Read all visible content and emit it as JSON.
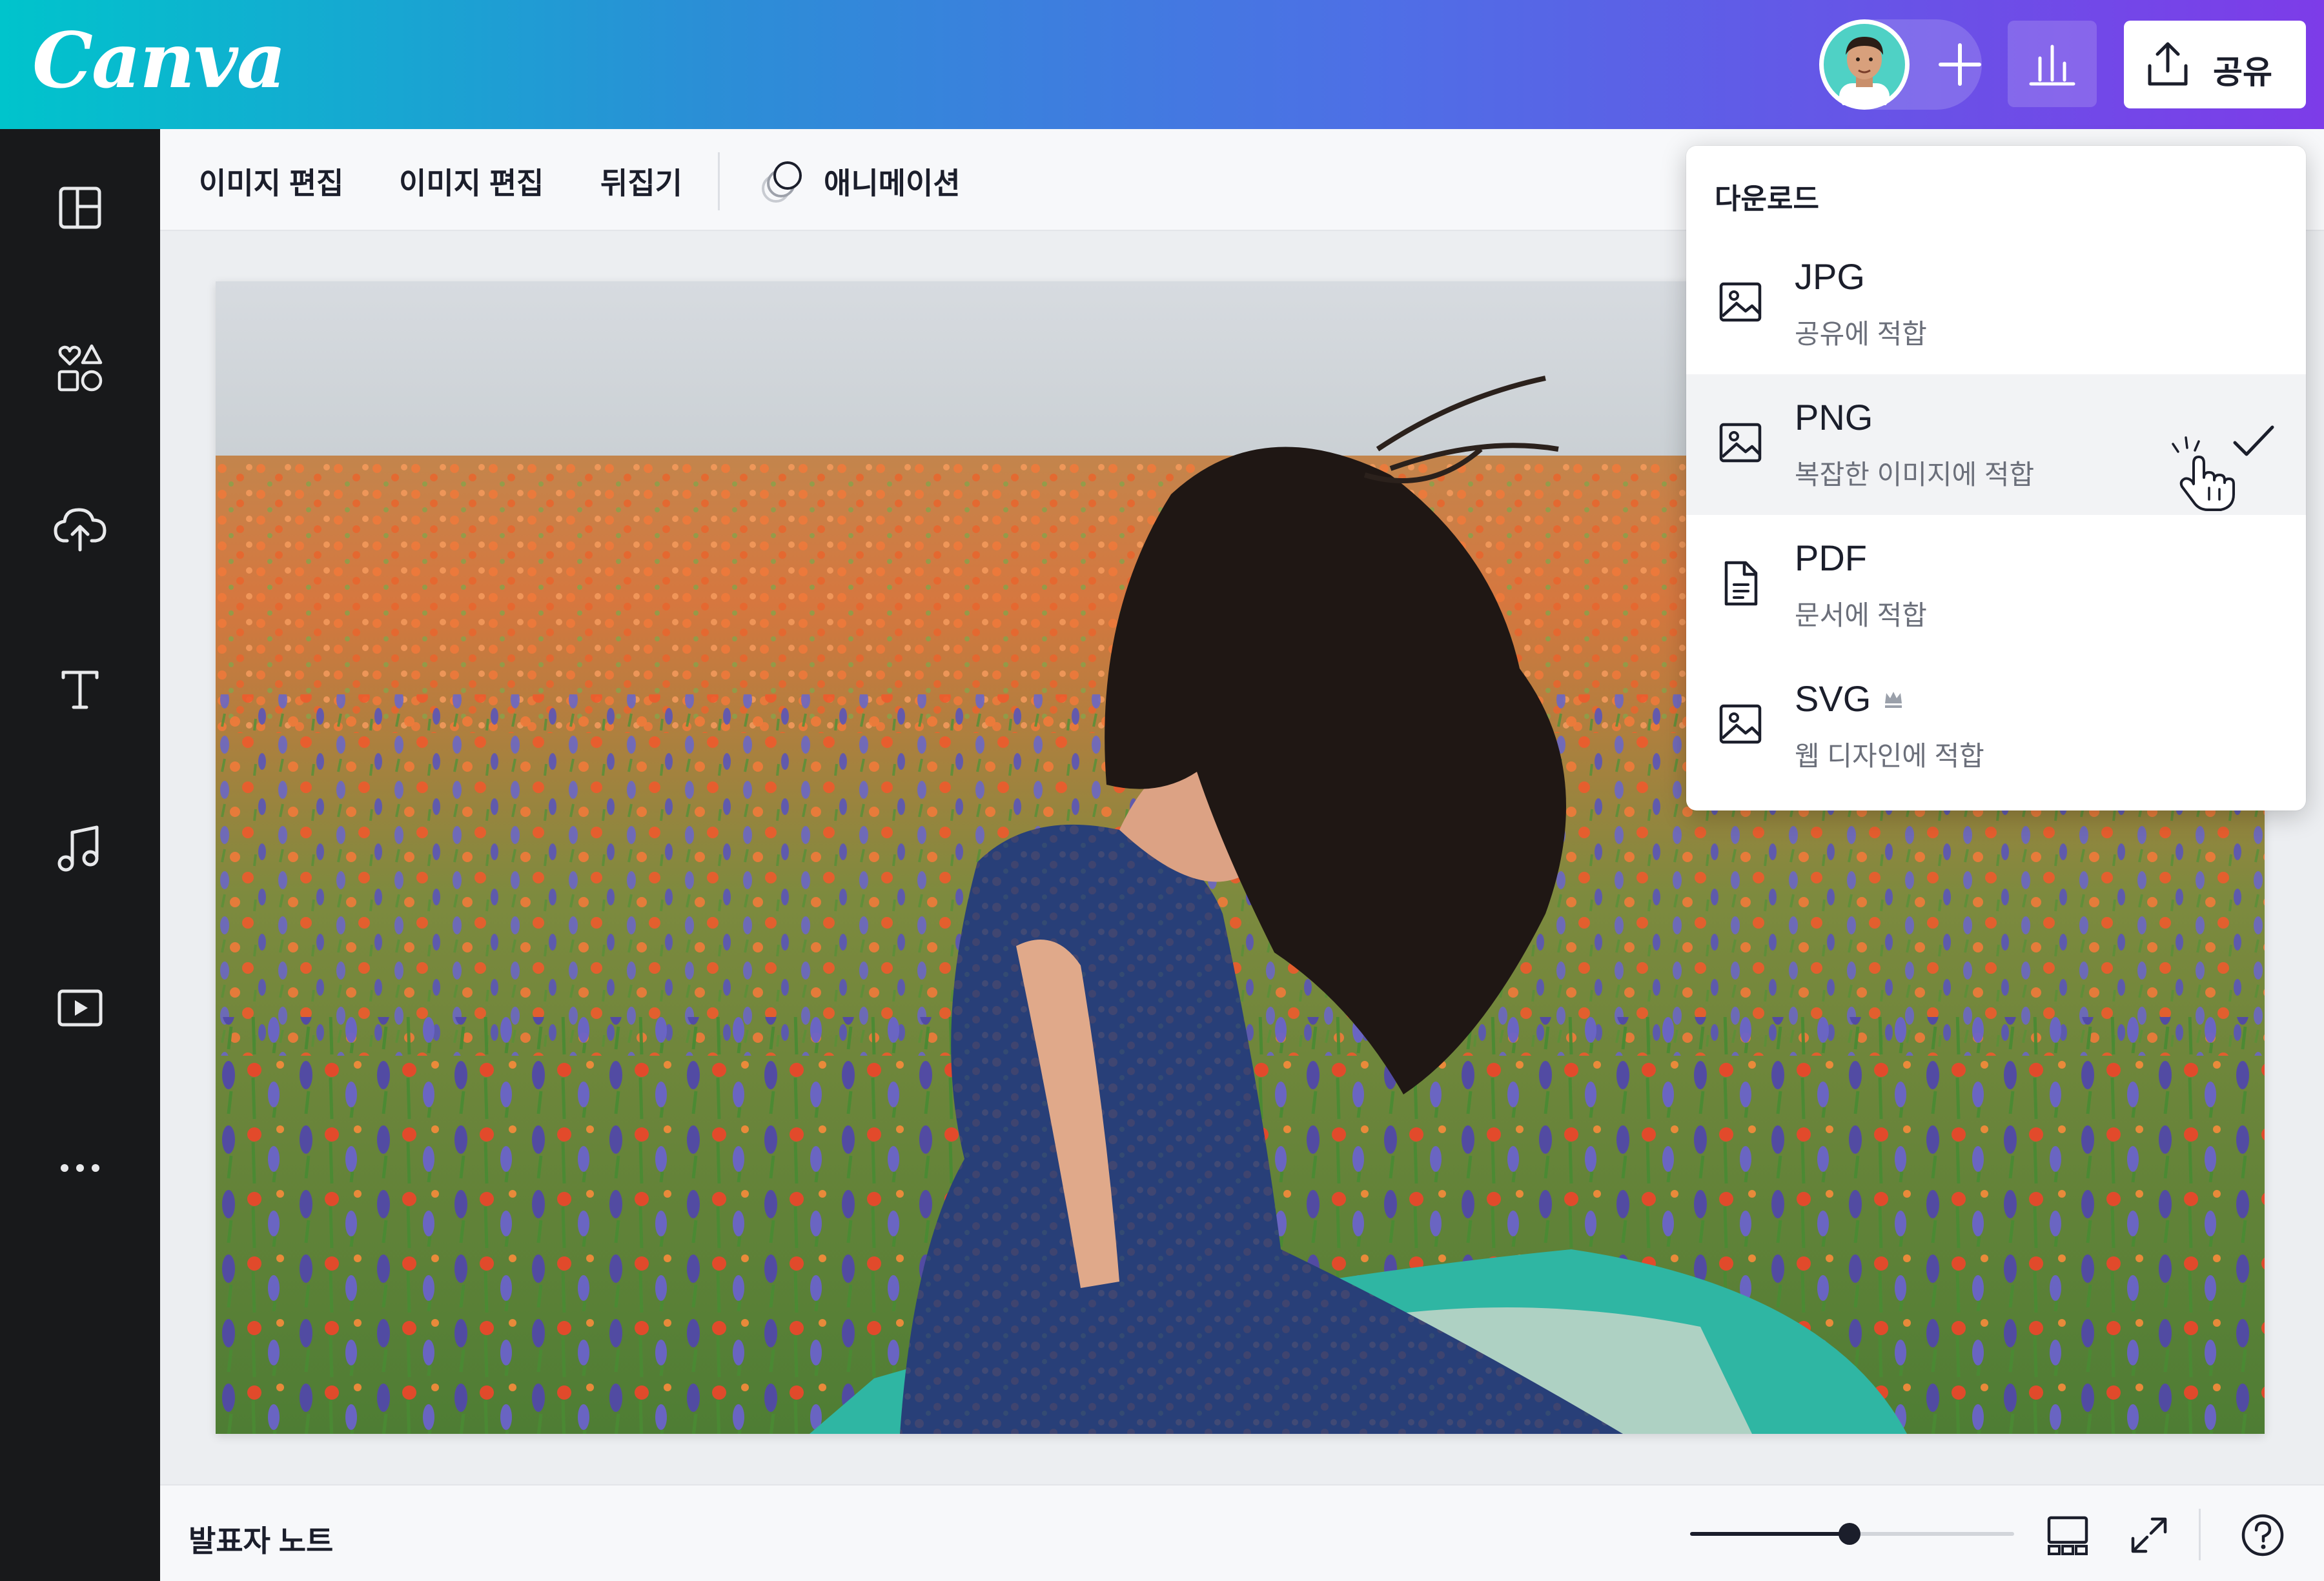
{
  "app": {
    "logo": "Canva"
  },
  "header": {
    "share_label": "공유",
    "add_icon": "plus-icon",
    "stats_icon": "bar-chart-icon",
    "share_icon": "upload-icon"
  },
  "sidebar": {
    "icons": [
      "layout-icon",
      "elements-icon",
      "upload-icon",
      "text-icon",
      "music-icon",
      "video-icon",
      "more-icon"
    ]
  },
  "toolbar": {
    "items": [
      "이미지 편집",
      "이미지 편집",
      "뒤집기"
    ],
    "animation_label": "애니메이션"
  },
  "download_menu": {
    "title": "다운로드",
    "options": [
      {
        "name": "JPG",
        "description": "공유에 적합",
        "icon": "image-icon",
        "selected": false,
        "premium": false
      },
      {
        "name": "PNG",
        "description": "복잡한 이미지에 적합",
        "icon": "image-icon",
        "selected": true,
        "premium": false
      },
      {
        "name": "PDF",
        "description": "문서에 적합",
        "icon": "document-icon",
        "selected": false,
        "premium": false
      },
      {
        "name": "SVG",
        "description": "웹 디자인에 적합",
        "icon": "image-icon",
        "selected": false,
        "premium": true
      }
    ]
  },
  "footer": {
    "notes_label": "발표자 노트",
    "zoom_level": 0.5
  },
  "colors": {
    "gradient_start": "#00c4cc",
    "gradient_end": "#7d3ce8",
    "sidebar_bg": "#18191b"
  }
}
